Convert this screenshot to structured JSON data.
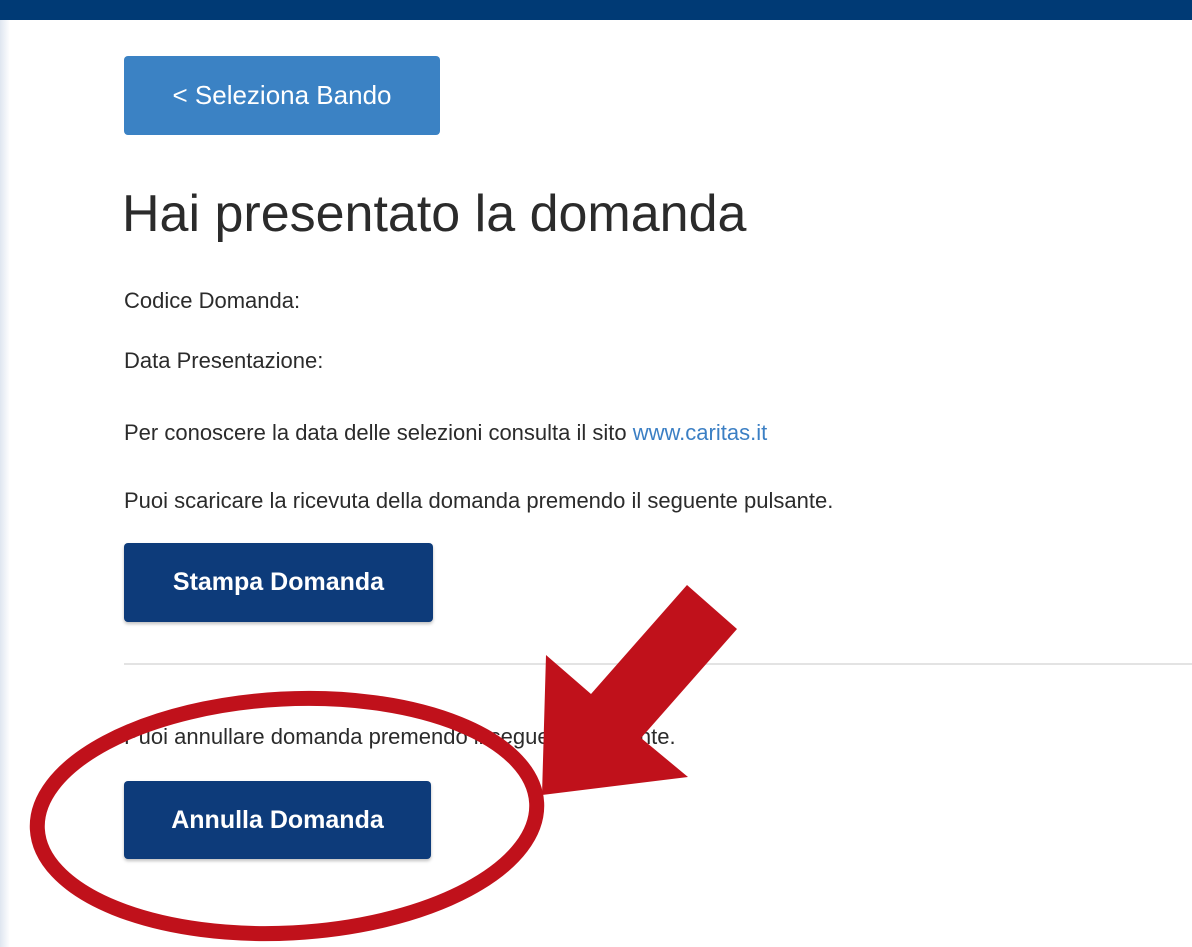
{
  "nav": {
    "back_label": "< Seleziona Bando"
  },
  "page": {
    "title": "Hai presentato la domanda",
    "codice_label": "Codice Domanda:",
    "data_label": "Data Presentazione:",
    "selezioni_text": "Per conoscere la data delle selezioni consulta il sito ",
    "selezioni_link": "www.caritas.it",
    "ricevuta_text": "Puoi scaricare la ricevuta della domanda premendo il seguente pulsante.",
    "print_label": "Stampa Domanda",
    "annulla_text": "Puoi annullare domanda premendo il seguente pulsante.",
    "cancel_label": "Annulla Domanda"
  },
  "colors": {
    "top_bar": "#003a75",
    "back_button": "#3b82c4",
    "primary_button": "#0d3b7a",
    "link": "#3b7fc4",
    "annotation": "#c0111b"
  },
  "annotation": {
    "circle": "red-ellipse-highlight",
    "arrow": "red-arrow-pointer"
  }
}
